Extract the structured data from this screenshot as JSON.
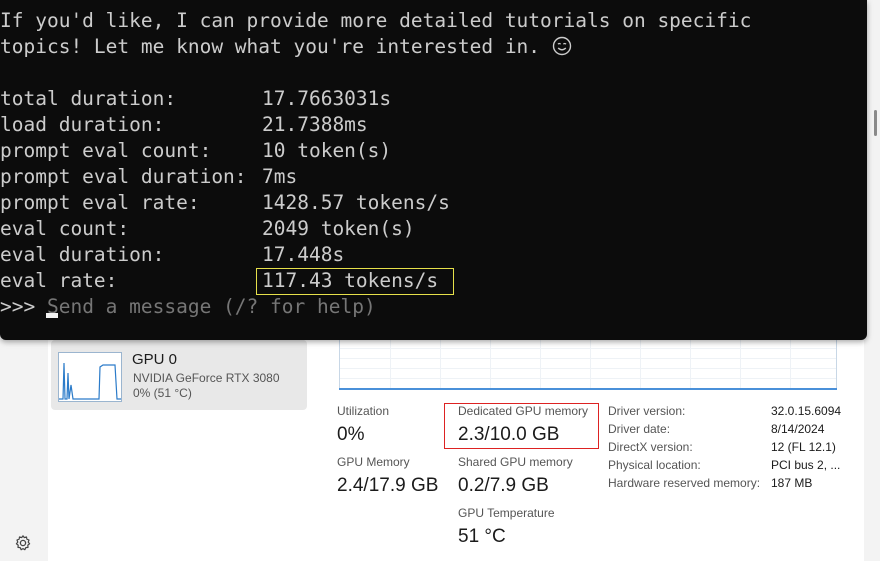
{
  "terminal": {
    "message_lines": [
      "If you'd like, I can provide more detailed tutorials on specific",
      "topics! Let me know what you're interested in."
    ],
    "emoji": "smiling-face-icon",
    "stats": [
      {
        "label": "total duration:",
        "value": "17.7663031s"
      },
      {
        "label": "load duration:",
        "value": "21.7388ms"
      },
      {
        "label": "prompt eval count:",
        "value": "10 token(s)"
      },
      {
        "label": "prompt eval duration:",
        "value": "7ms"
      },
      {
        "label": "prompt eval rate:",
        "value": "1428.57 tokens/s"
      },
      {
        "label": "eval count:",
        "value": "2049 token(s)"
      },
      {
        "label": "eval duration:",
        "value": "17.448s"
      },
      {
        "label": "eval rate:",
        "value": "117.43 tokens/s"
      }
    ],
    "prompt": ">>> ",
    "prompt_placeholder": "Send a message (/? for help)",
    "highlight_color": "#e6e04a"
  },
  "gpu_card": {
    "name": "GPU 0",
    "model": "NVIDIA GeForce RTX 3080",
    "utilization": "0% (51 °C)"
  },
  "stats": {
    "utilization_label": "Utilization",
    "utilization_value": "0%",
    "dedicated_label": "Dedicated GPU memory",
    "dedicated_value": "2.3/10.0 GB",
    "gpu_memory_label": "GPU Memory",
    "gpu_memory_value": "2.4/17.9 GB",
    "shared_label": "Shared GPU memory",
    "shared_value": "0.2/7.9 GB",
    "temp_label": "GPU Temperature",
    "temp_value": "51 °C",
    "highlight_color": "#dd2222"
  },
  "info": [
    {
      "label": "Driver version:",
      "value": "32.0.15.6094"
    },
    {
      "label": "Driver date:",
      "value": "8/14/2024"
    },
    {
      "label": "DirectX version:",
      "value": "12 (FL 12.1)"
    },
    {
      "label": "Physical location:",
      "value": "PCI bus 2, ..."
    },
    {
      "label": "Hardware reserved memory:",
      "value": "187 MB"
    }
  ],
  "icons": {
    "settings": "gear-icon"
  }
}
